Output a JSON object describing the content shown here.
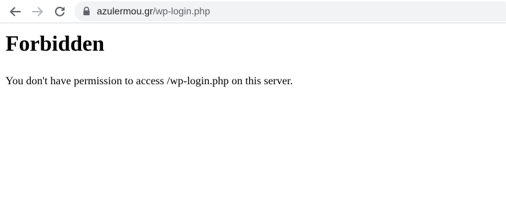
{
  "browser": {
    "url_host": "azulermou.gr",
    "url_path": "/wp-login.php",
    "icons": {
      "back": "back-arrow-icon",
      "forward": "forward-arrow-icon",
      "reload": "reload-icon",
      "lock": "lock-icon"
    }
  },
  "page": {
    "heading": "Forbidden",
    "message": "You don't have permission to access /wp-login.php on this server."
  }
}
